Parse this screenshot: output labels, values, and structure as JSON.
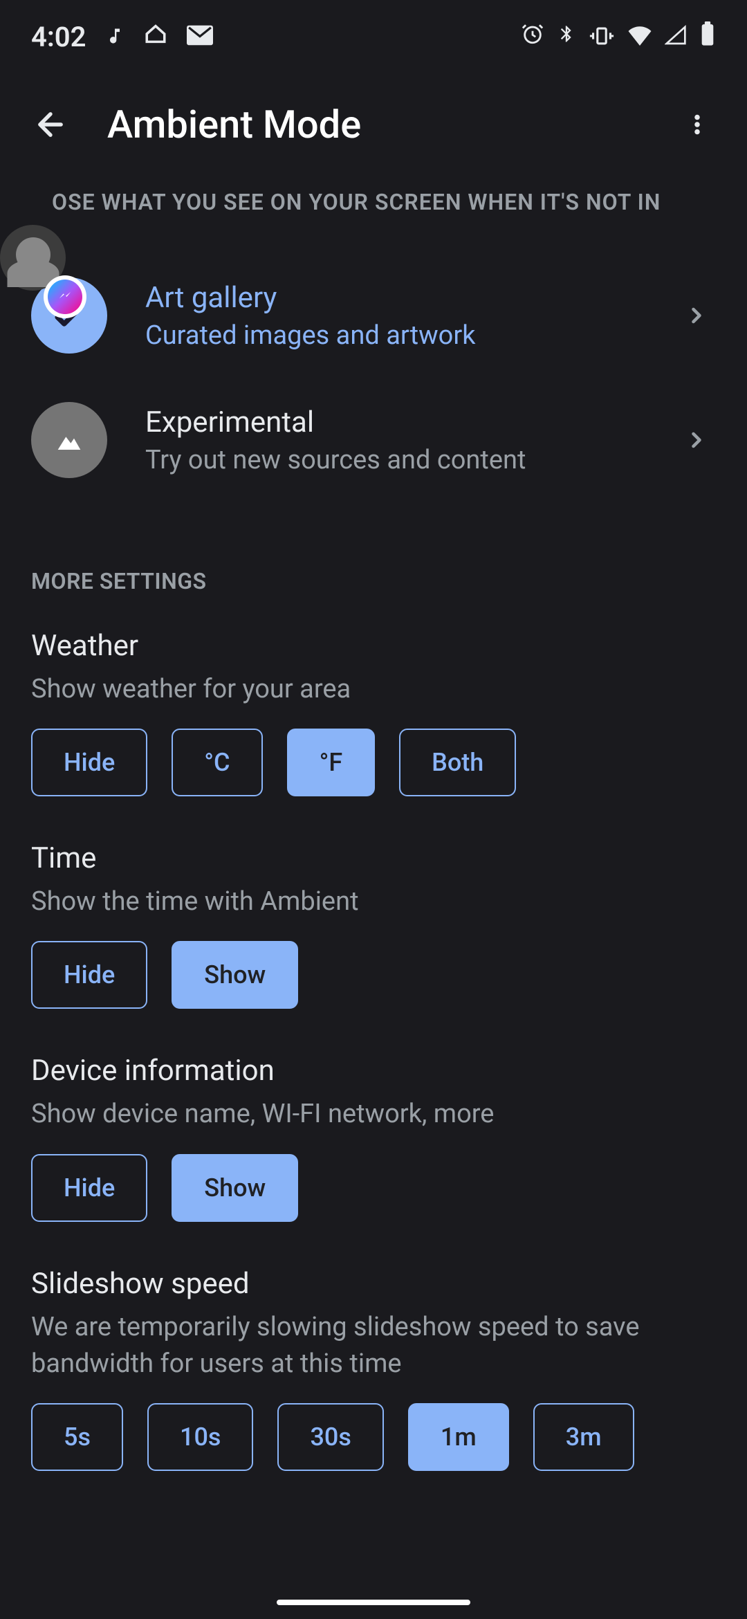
{
  "status": {
    "time": "4:02"
  },
  "appbar": {
    "title": "Ambient Mode"
  },
  "header": {
    "label": "OSE WHAT YOU SEE ON YOUR SCREEN WHEN IT'S NOT IN"
  },
  "options": [
    {
      "title": "Art gallery",
      "subtitle": "Curated images and artwork",
      "selected": true
    },
    {
      "title": "Experimental",
      "subtitle": "Try out new sources and content",
      "selected": false
    }
  ],
  "moreSettings": {
    "label": "MORE SETTINGS"
  },
  "settings": {
    "weather": {
      "title": "Weather",
      "description": "Show weather for your area",
      "buttons": [
        "Hide",
        "°C",
        "°F",
        "Both"
      ],
      "selected": 2
    },
    "time": {
      "title": "Time",
      "description": "Show the time with Ambient",
      "buttons": [
        "Hide",
        "Show"
      ],
      "selected": 1
    },
    "deviceInfo": {
      "title": "Device information",
      "description": "Show device name, WI-FI network, more",
      "buttons": [
        "Hide",
        "Show"
      ],
      "selected": 1
    },
    "slideshow": {
      "title": "Slideshow speed",
      "description": "We are temporarily slowing slideshow speed to save bandwidth for users at this time",
      "buttons": [
        "5s",
        "10s",
        "30s",
        "1m",
        "3m"
      ],
      "selected": 3
    }
  }
}
